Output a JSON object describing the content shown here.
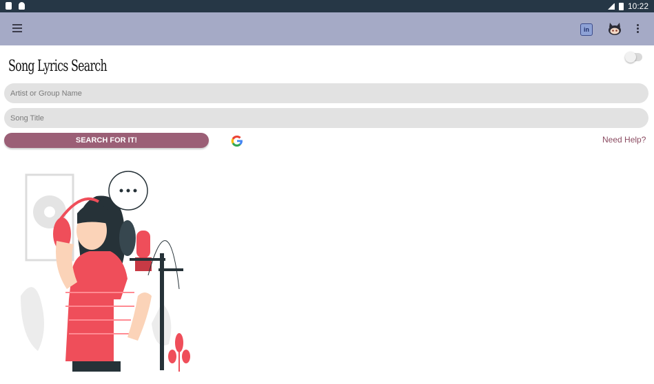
{
  "status_bar": {
    "time": "10:22",
    "network": "LTE"
  },
  "app_bar": {
    "menu_icon": "menu-icon",
    "linkedin_icon": "linkedin-icon",
    "linkedin_glyph": "in",
    "github_icon": "github-icon",
    "overflow_icon": "overflow-menu-icon"
  },
  "header": {
    "title": "Song Lyrics Search",
    "toggle_on": false
  },
  "form": {
    "artist_placeholder": "Artist or Group Name",
    "artist_value": "",
    "song_placeholder": "Song Title",
    "song_value": "",
    "search_label": "SEARCH FOR IT!",
    "help_label": "Need Help?"
  },
  "colors": {
    "status_bar": "#263746",
    "app_bar": "#a5aac6",
    "button": "#9b5f76",
    "help_link": "#8a4a60",
    "field": "#e2e2e2",
    "illustration_accent": "#ef4e5a"
  }
}
